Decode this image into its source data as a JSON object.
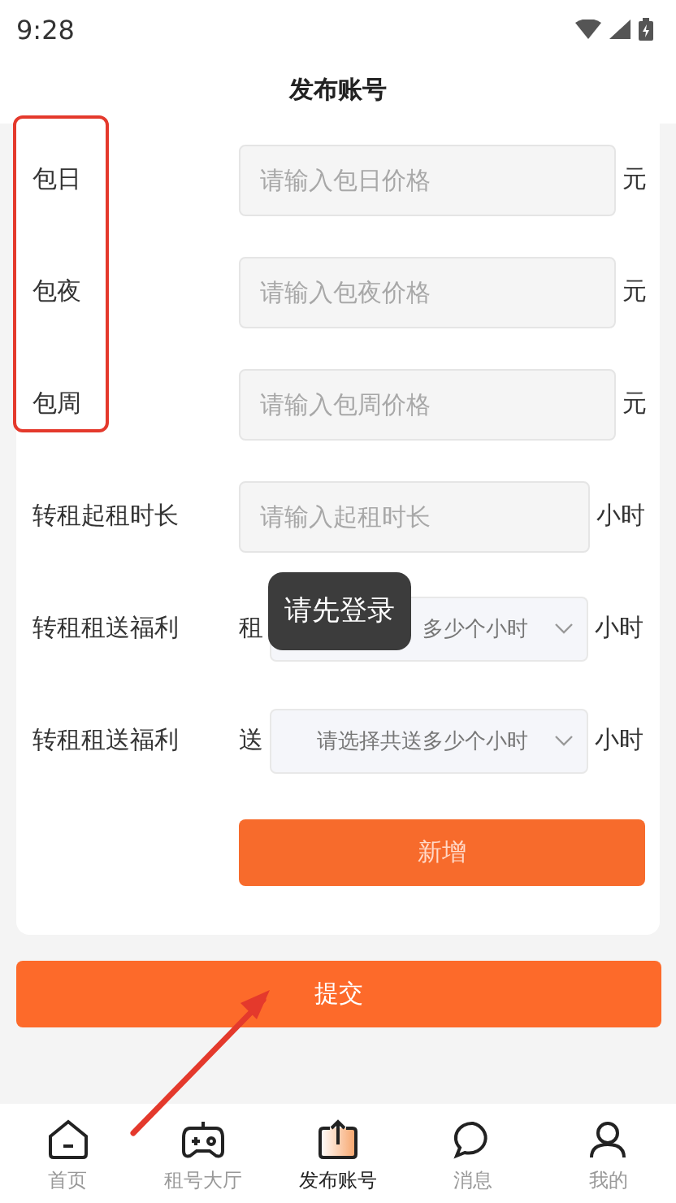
{
  "status_bar": {
    "time": "9:28"
  },
  "title": "发布账号",
  "price_rows": [
    {
      "label": "包日",
      "placeholder": "请输入包日价格",
      "unit": "元"
    },
    {
      "label": "包夜",
      "placeholder": "请输入包夜价格",
      "unit": "元"
    },
    {
      "label": "包周",
      "placeholder": "请输入包周价格",
      "unit": "元"
    }
  ],
  "duration_row": {
    "label": "转租起租时长",
    "placeholder": "请输入起租时长",
    "unit": "小时"
  },
  "bonus_rows": [
    {
      "label": "转租租送福利",
      "prefix": "租",
      "placeholder": "多少个小时",
      "unit": "小时"
    },
    {
      "label": "转租租送福利",
      "prefix": "送",
      "placeholder": "请选择共送多少个小时",
      "unit": "小时"
    }
  ],
  "add_button": "新增",
  "submit_button": "提交",
  "toast": "请先登录",
  "tabs": [
    {
      "label": "首页",
      "selected": false
    },
    {
      "label": "租号大厅",
      "selected": false
    },
    {
      "label": "发布账号",
      "selected": true
    },
    {
      "label": "消息",
      "selected": false
    },
    {
      "label": "我的",
      "selected": false
    }
  ]
}
